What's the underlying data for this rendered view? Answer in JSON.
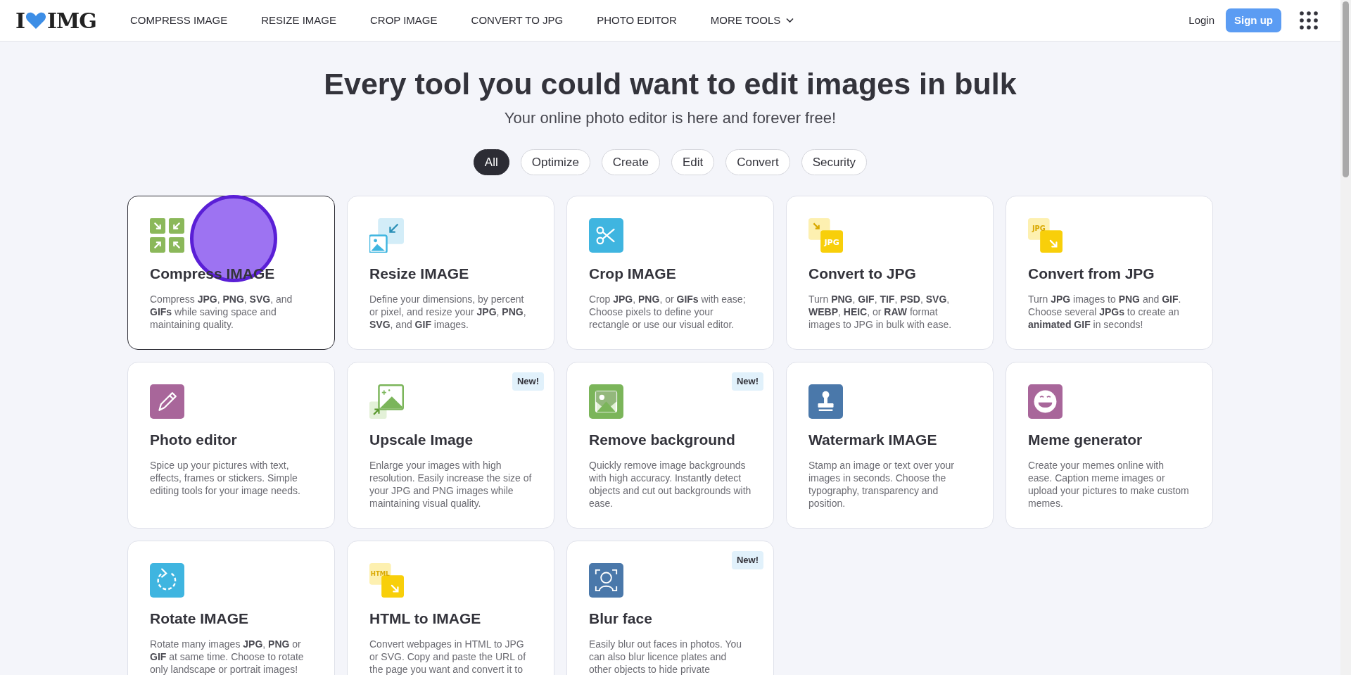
{
  "logo": {
    "left": "I",
    "right": "IMG"
  },
  "nav": [
    {
      "label": "COMPRESS IMAGE",
      "kind": "link"
    },
    {
      "label": "RESIZE IMAGE",
      "kind": "link"
    },
    {
      "label": "CROP IMAGE",
      "kind": "link"
    },
    {
      "label": "CONVERT TO JPG",
      "kind": "link"
    },
    {
      "label": "PHOTO EDITOR",
      "kind": "link"
    },
    {
      "label": "MORE TOOLS",
      "kind": "dropdown"
    }
  ],
  "account": {
    "login": "Login",
    "signup": "Sign up"
  },
  "heading": "Every tool you could want to edit images in bulk",
  "subheading": "Your online photo editor is here and forever free!",
  "filters": [
    {
      "label": "All",
      "selected": true
    },
    {
      "label": "Optimize",
      "selected": false
    },
    {
      "label": "Create",
      "selected": false
    },
    {
      "label": "Edit",
      "selected": false
    },
    {
      "label": "Convert",
      "selected": false
    },
    {
      "label": "Security",
      "selected": false
    }
  ],
  "tools": [
    {
      "title": "Compress IMAGE",
      "description": "Compress **JPG**, **PNG**, **SVG**, and **GIFs** while saving space and maintaining quality.",
      "selected": true
    },
    {
      "title": "Resize IMAGE",
      "description": "Define your dimensions, by percent or pixel, and resize your **JPG**, **PNG**, **SVG**, and **GIF** images.",
      "selected": false
    },
    {
      "title": "Crop IMAGE",
      "description": "Crop **JPG**, **PNG**, or **GIFs** with ease; Choose pixels to define your rectangle or use our visual editor.",
      "selected": false
    },
    {
      "title": "Convert to JPG",
      "description": "Turn **PNG**, **GIF**, **TIF**, **PSD**, **SVG**, **WEBP**, **HEIC**, or **RAW** format images to JPG in bulk with ease.",
      "selected": false,
      "icon_text": "JPG"
    },
    {
      "title": "Convert from JPG",
      "description": "Turn **JPG** images to **PNG** and **GIF**. Choose several **JPGs** to create an **animated GIF** in seconds!",
      "selected": false,
      "icon_text": "JPG"
    },
    {
      "title": "Photo editor",
      "description": "Spice up your pictures with text, effects, frames or stickers. Simple editing tools for your image needs.",
      "selected": false
    },
    {
      "title": "Upscale Image",
      "description": "Enlarge your images with high resolution. Easily increase the size of your JPG and PNG images while maintaining visual quality.",
      "selected": false,
      "badge": "New!"
    },
    {
      "title": "Remove background",
      "description": "Quickly remove image backgrounds with high accuracy. Instantly detect objects and cut out backgrounds with ease.",
      "selected": false,
      "badge": "New!"
    },
    {
      "title": "Watermark IMAGE",
      "description": "Stamp an image or text over your images in seconds. Choose the typography, transparency and position.",
      "selected": false
    },
    {
      "title": "Meme generator",
      "description": "Create your memes online with ease. Caption meme images or upload your pictures to make custom memes.",
      "selected": false
    },
    {
      "title": "Rotate IMAGE",
      "description": "Rotate many images **JPG**, **PNG** or **GIF** at same time. Choose to rotate only landscape or portrait images!",
      "selected": false
    },
    {
      "title": "HTML to IMAGE",
      "description": "Convert webpages in HTML to JPG or SVG. Copy and paste the URL of the page you want and convert it to",
      "selected": false,
      "icon_text": "HTML"
    },
    {
      "title": "Blur face",
      "description": "Easily blur out faces in photos. You can also blur licence plates and other objects to hide private",
      "selected": false,
      "badge": "New!"
    }
  ]
}
